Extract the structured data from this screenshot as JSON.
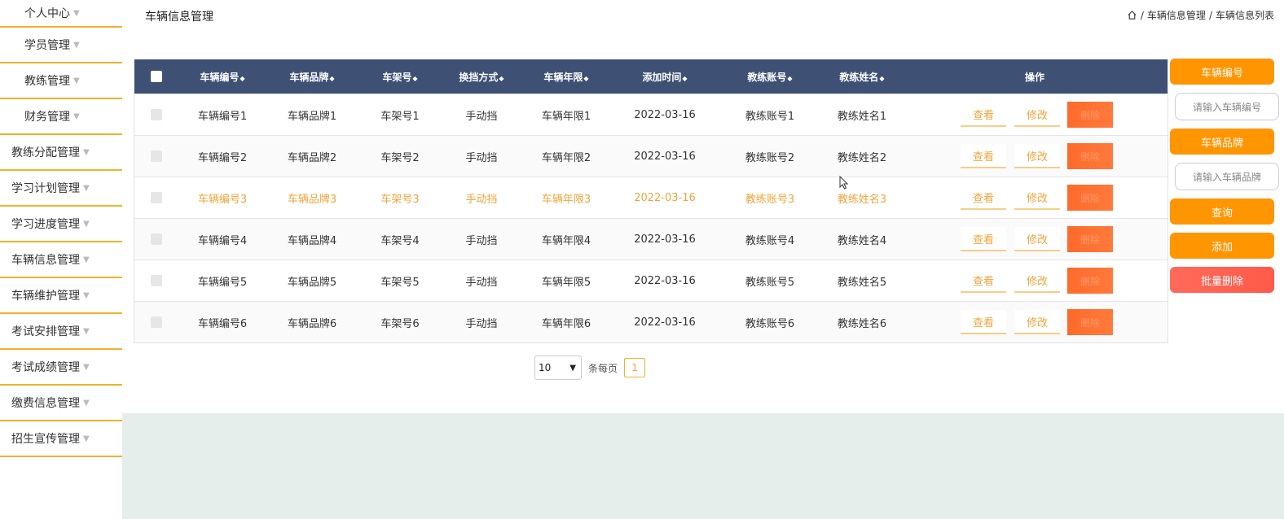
{
  "sidebar": {
    "items": [
      {
        "label": "个人中心",
        "kind": "sub"
      },
      {
        "label": "学员管理",
        "kind": "sub"
      },
      {
        "label": "教练管理",
        "kind": "sub"
      },
      {
        "label": "财务管理",
        "kind": "sub"
      },
      {
        "label": "教练分配管理",
        "kind": "top"
      },
      {
        "label": "学习计划管理",
        "kind": "top"
      },
      {
        "label": "学习进度管理",
        "kind": "top"
      },
      {
        "label": "车辆信息管理",
        "kind": "top"
      },
      {
        "label": "车辆维护管理",
        "kind": "top"
      },
      {
        "label": "考试安排管理",
        "kind": "top"
      },
      {
        "label": "考试成绩管理",
        "kind": "top"
      },
      {
        "label": "缴费信息管理",
        "kind": "top"
      },
      {
        "label": "招生宣传管理",
        "kind": "top"
      }
    ]
  },
  "header": {
    "title": "车辆信息管理",
    "breadcrumb": [
      "车辆信息管理",
      "车辆信息列表"
    ]
  },
  "table": {
    "columns": [
      "车辆编号",
      "车辆品牌",
      "车架号",
      "换挡方式",
      "车辆年限",
      "添加时间",
      "教练账号",
      "教练姓名",
      "操作"
    ],
    "rows": [
      [
        "车辆编号1",
        "车辆品牌1",
        "车架号1",
        "手动挡",
        "车辆年限1",
        "2022-03-16",
        "教练账号1",
        "教练姓名1"
      ],
      [
        "车辆编号2",
        "车辆品牌2",
        "车架号2",
        "手动挡",
        "车辆年限2",
        "2022-03-16",
        "教练账号2",
        "教练姓名2"
      ],
      [
        "车辆编号3",
        "车辆品牌3",
        "车架号3",
        "手动挡",
        "车辆年限3",
        "2022-03-16",
        "教练账号3",
        "教练姓名3"
      ],
      [
        "车辆编号4",
        "车辆品牌4",
        "车架号4",
        "手动挡",
        "车辆年限4",
        "2022-03-16",
        "教练账号4",
        "教练姓名4"
      ],
      [
        "车辆编号5",
        "车辆品牌5",
        "车架号5",
        "手动挡",
        "车辆年限5",
        "2022-03-16",
        "教练账号5",
        "教练姓名5"
      ],
      [
        "车辆编号6",
        "车辆品牌6",
        "车架号6",
        "手动挡",
        "车辆年限6",
        "2022-03-16",
        "教练账号6",
        "教练姓名6"
      ]
    ],
    "highlighted_row": 2,
    "actions": {
      "view": "查看",
      "edit": "修改",
      "delete": "删除"
    }
  },
  "pagination": {
    "page_size": "10",
    "per_page_label": "条每页",
    "current_page": "1"
  },
  "search_panel": {
    "field1_label": "车辆编号",
    "field1_placeholder": "请输入车辆编号",
    "field2_label": "车辆品牌",
    "field2_placeholder": "请输入车辆品牌",
    "query": "查询",
    "add": "添加",
    "batch_delete": "批量删除"
  },
  "colors": {
    "accent": "#ff9500",
    "header_bg": "#3e5174",
    "delete": "#ff6a2a",
    "highlight_text": "#f0a43a",
    "sidebar_line": "#f0b22c"
  },
  "icons": {
    "home": "home-icon",
    "sort": "sort-icon",
    "dropdown": "chevron-down-icon"
  }
}
